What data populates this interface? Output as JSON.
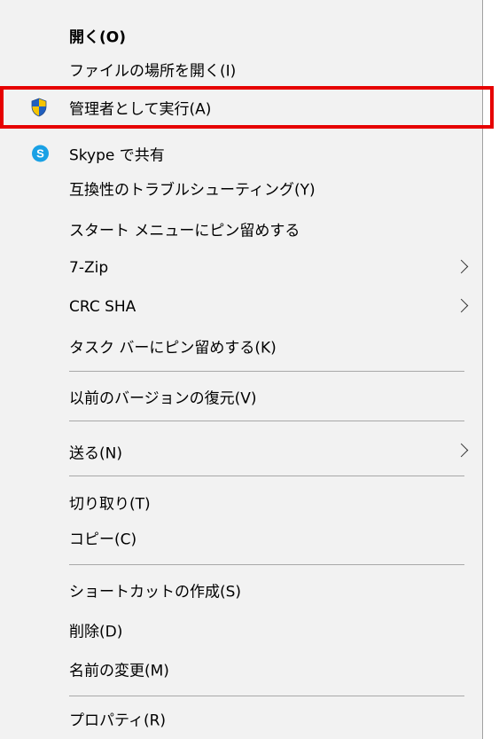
{
  "menu": {
    "items": [
      {
        "label": "開く(O)"
      },
      {
        "label": "ファイルの場所を開く(I)"
      },
      {
        "label": "管理者として実行(A)",
        "icon": "uac-shield-icon"
      },
      {
        "label": "Skype で共有",
        "icon": "skype-icon",
        "icon_text": "S"
      },
      {
        "label": "互換性のトラブルシューティング(Y)"
      },
      {
        "label": "スタート メニューにピン留めする"
      },
      {
        "label": "7-Zip"
      },
      {
        "label": "CRC SHA"
      },
      {
        "label": "タスク バーにピン留めする(K)"
      },
      {
        "label": "以前のバージョンの復元(V)"
      },
      {
        "label": "送る(N)"
      },
      {
        "label": "切り取り(T)"
      },
      {
        "label": "コピー(C)"
      },
      {
        "label": "ショートカットの作成(S)"
      },
      {
        "label": "削除(D)"
      },
      {
        "label": "名前の変更(M)"
      },
      {
        "label": "プロパティ(R)"
      }
    ]
  },
  "colors": {
    "highlight_border": "#e60000",
    "menu_background": "#f2f2f2",
    "separator": "#a8a8a8",
    "skype_blue": "#1aa1e5",
    "shield_blue": "#1f5fbf",
    "shield_yellow": "#f5c400"
  }
}
